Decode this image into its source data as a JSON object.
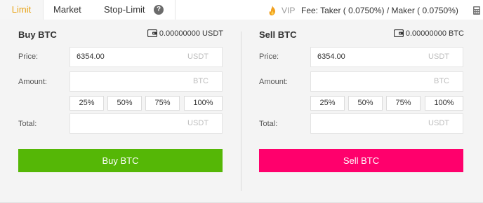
{
  "tabs": {
    "limit": "Limit",
    "market": "Market",
    "stop_limit": "Stop-Limit",
    "help": "?"
  },
  "fee_bar": {
    "vip": "VIP",
    "fee_text": "Fee: Taker ( 0.0750%) / Maker ( 0.0750%)"
  },
  "buy": {
    "title": "Buy BTC",
    "balance": "0.00000000 USDT",
    "price_label": "Price:",
    "price_value": "6354.00",
    "price_unit": "USDT",
    "amount_label": "Amount:",
    "amount_unit": "BTC",
    "percent": [
      "25%",
      "50%",
      "75%",
      "100%"
    ],
    "total_label": "Total:",
    "total_unit": "USDT",
    "button": "Buy BTC"
  },
  "sell": {
    "title": "Sell BTC",
    "balance": "0.00000000 BTC",
    "price_label": "Price:",
    "price_value": "6354.00",
    "price_unit": "USDT",
    "amount_label": "Amount:",
    "amount_unit": "BTC",
    "percent": [
      "25%",
      "50%",
      "75%",
      "100%"
    ],
    "total_label": "Total:",
    "total_unit": "USDT",
    "button": "Sell BTC"
  },
  "icons": {
    "help": "question-circle-icon",
    "vip": "vip-flame-icon",
    "calculator": "calculator-icon",
    "wallet": "wallet-icon"
  },
  "colors": {
    "active_tab": "#e8a317",
    "buy": "#55b706",
    "sell": "#ff006c"
  }
}
